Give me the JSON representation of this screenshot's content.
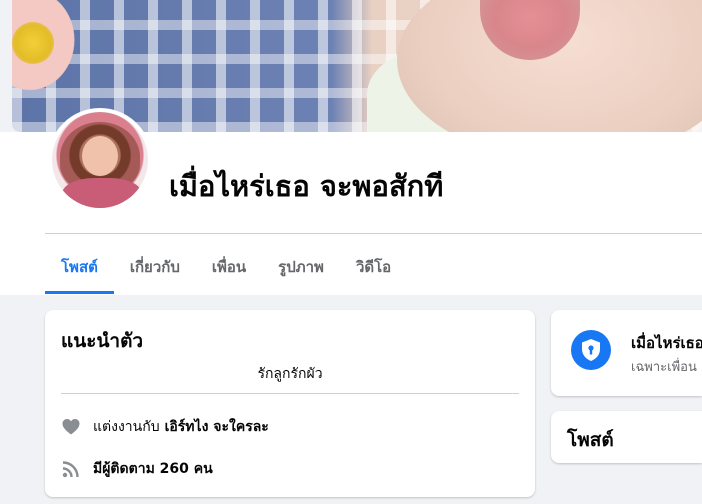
{
  "profile": {
    "name": "เมื่อไหร่เธอ จะพอสักที"
  },
  "tabs": [
    {
      "label": "โพสต์",
      "active": true
    },
    {
      "label": "เกี่ยวกับ",
      "active": false
    },
    {
      "label": "เพื่อน",
      "active": false
    },
    {
      "label": "รูปภาพ",
      "active": false
    },
    {
      "label": "วิดีโอ",
      "active": false
    }
  ],
  "intro": {
    "title": "แนะนำตัว",
    "bio": "รักลูกรักผัว",
    "relationship": {
      "prefix": "แต่งงานกับ",
      "partner": "เอิร์ทไง จะใครละ",
      "icon": "heart-icon"
    },
    "followers": {
      "text": "มีผู้ติดตาม 260 คน",
      "icon": "rss-icon"
    }
  },
  "privacy_card": {
    "title": "เมื่อไหร่เธอ",
    "subtitle": "เฉพาะเพื่อน",
    "icon": "shield-lock-icon"
  },
  "posts_card": {
    "title": "โพสต์"
  },
  "colors": {
    "accent": "#1877f2",
    "page_bg": "#f0f2f5",
    "secondary_text": "#65676b"
  }
}
